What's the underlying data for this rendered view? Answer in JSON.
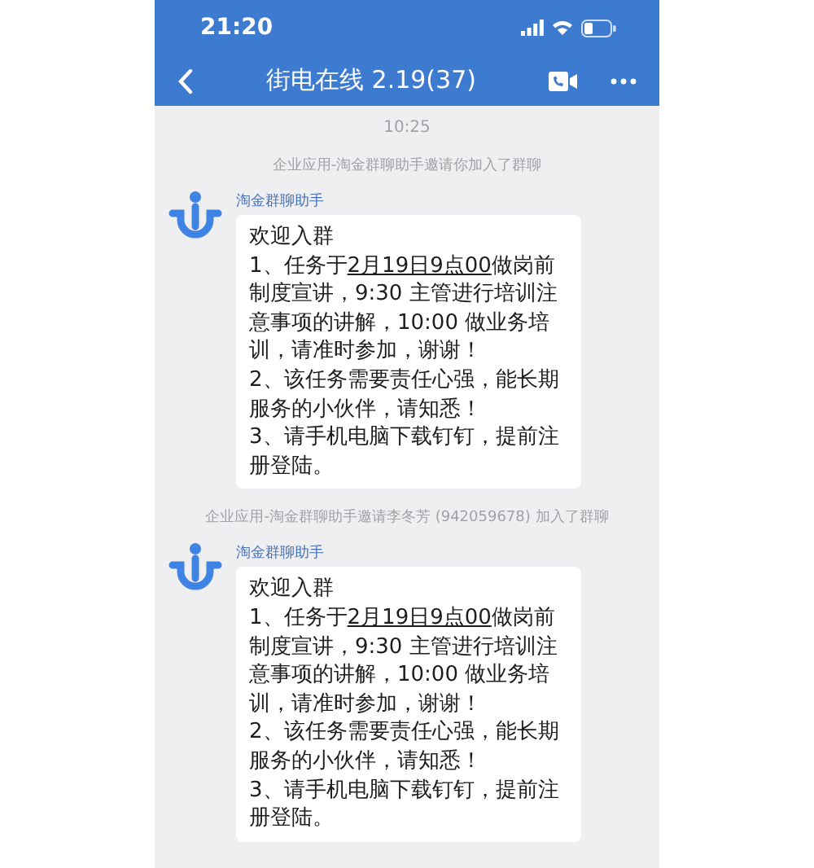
{
  "status_bar": {
    "time": "21:20"
  },
  "nav": {
    "title": "街电在线 2.19(37)"
  },
  "messages": [
    {
      "kind": "time",
      "text": "10:25"
    },
    {
      "kind": "system",
      "text": "企业应用-淘金群聊助手邀请你加入了群聊"
    },
    {
      "kind": "chat",
      "sender": "淘金群聊助手",
      "paragraphs": [
        {
          "text": "欢迎入群"
        },
        {
          "before": "1、任务于",
          "link": "2月19日9点00",
          "after": "做岗前制度宣讲，9:30 主管进行培训注意事项的讲解，10:00 做业务培训，请准时参加，谢谢！"
        },
        {
          "text": "2、该任务需要责任心强，能长期服务的小伙伴，请知悉！"
        },
        {
          "text": "3、请手机电脑下载钉钉，提前注册登陆。"
        }
      ]
    },
    {
      "kind": "system",
      "text": "企业应用-淘金群聊助手邀请李冬芳 (942059678) 加入了群聊"
    },
    {
      "kind": "chat",
      "sender": "淘金群聊助手",
      "paragraphs": [
        {
          "text": "欢迎入群"
        },
        {
          "before": "1、任务于",
          "link": "2月19日9点00",
          "after": "做岗前制度宣讲，9:30 主管进行培训注意事项的讲解，10:00 做业务培训，请准时参加，谢谢！"
        },
        {
          "text": "2、该任务需要责任心强，能长期服务的小伙伴，请知悉！"
        },
        {
          "text": "3、请手机电脑下载钉钉，提前注册登陆。"
        }
      ]
    }
  ]
}
